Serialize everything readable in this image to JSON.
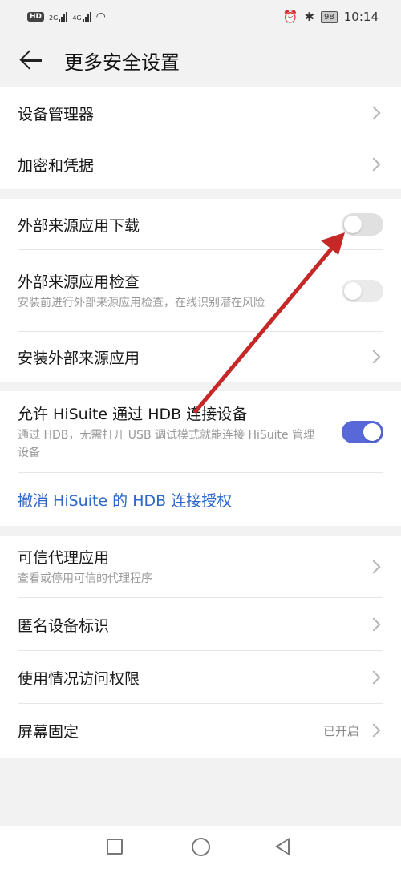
{
  "status_bar": {
    "hd": "HD",
    "signal_1": "2G",
    "signal_2": "4G",
    "battery": "98",
    "time": "10:14"
  },
  "header": {
    "title": "更多安全设置",
    "back_icon": "arrow-left-icon"
  },
  "group1": [
    {
      "label": "设备管理器"
    },
    {
      "label": "加密和凭据"
    }
  ],
  "group2": {
    "external_download": {
      "label": "外部来源应用下载",
      "toggle": false
    },
    "external_check": {
      "label": "外部来源应用检查",
      "sub": "安装前进行外部来源应用检查，在线识别潜在风险",
      "toggle": false
    },
    "install_external": {
      "label": "安装外部来源应用"
    }
  },
  "group3": {
    "hisuite": {
      "label": "允许 HiSuite 通过 HDB 连接设备",
      "sub": "通过 HDB，无需打开 USB 调试模式就能连接 HiSuite 管理设备",
      "toggle": true
    },
    "revoke": {
      "label": "撤消 HiSuite 的 HDB 连接授权"
    }
  },
  "group4": {
    "trust_agents": {
      "label": "可信代理应用",
      "sub": "查看或停用可信的代理程序"
    },
    "anonymous_id": {
      "label": "匿名设备标识"
    },
    "usage_access": {
      "label": "使用情况访问权限"
    },
    "screen_pinning": {
      "label": "屏幕固定",
      "value": "已开启"
    }
  },
  "colors": {
    "accent": "#5968d9",
    "link": "#2f68c8",
    "arrow": "#c62828"
  }
}
